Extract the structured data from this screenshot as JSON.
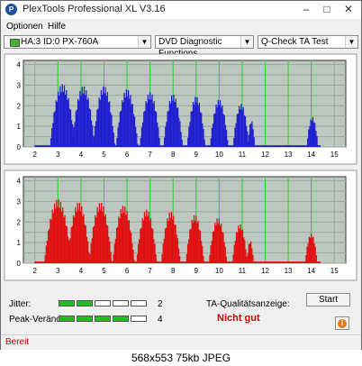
{
  "window": {
    "title": "PlexTools Professional XL V3.16",
    "app_icon_letter": "P"
  },
  "menu": [
    "Optionen",
    "Hilfe"
  ],
  "toolbar": {
    "drive": "HA:3 ID:0  PX-760A",
    "function": "DVD Diagnostic Functions",
    "test": "Q-Check TA Test"
  },
  "chart_data": [
    {
      "type": "bar",
      "name": "top-blue",
      "color": "#1f1fd0",
      "y_ticks": [
        "4",
        "3.5",
        "3",
        "2.5",
        "2",
        "1.5",
        "1",
        "0.5",
        "0"
      ],
      "x_ticks": [
        "2",
        "3",
        "4",
        "5",
        "6",
        "7",
        "8",
        "9",
        "10",
        "11",
        "12",
        "13",
        "14",
        "15"
      ],
      "xlim": [
        1.5,
        15.5
      ],
      "ylim": [
        0,
        4.2
      ],
      "peaks": [
        {
          "center": 3.2,
          "height": 3.05,
          "width": 0.55
        },
        {
          "center": 4.1,
          "height": 2.95,
          "width": 0.5
        },
        {
          "center": 5.0,
          "height": 2.95,
          "width": 0.48
        },
        {
          "center": 6.0,
          "height": 2.8,
          "width": 0.48
        },
        {
          "center": 7.0,
          "height": 2.65,
          "width": 0.45
        },
        {
          "center": 8.0,
          "height": 2.55,
          "width": 0.42
        },
        {
          "center": 9.0,
          "height": 2.45,
          "width": 0.4
        },
        {
          "center": 10.0,
          "height": 2.3,
          "width": 0.4
        },
        {
          "center": 10.95,
          "height": 2.1,
          "width": 0.35
        },
        {
          "center": 11.4,
          "height": 1.3,
          "width": 0.15
        },
        {
          "center": 14.05,
          "height": 1.45,
          "width": 0.25
        }
      ]
    },
    {
      "type": "bar",
      "name": "bottom-red",
      "color": "#e01010",
      "y_ticks": [
        "4",
        "3.5",
        "3",
        "2.5",
        "2",
        "1.5",
        "1",
        "0.5",
        "0"
      ],
      "x_ticks": [
        "2",
        "3",
        "4",
        "5",
        "6",
        "7",
        "8",
        "9",
        "10",
        "11",
        "12",
        "13",
        "14",
        "15"
      ],
      "xlim": [
        1.5,
        15.5
      ],
      "ylim": [
        0,
        4.2
      ],
      "peaks": [
        {
          "center": 3.0,
          "height": 3.1,
          "width": 0.6
        },
        {
          "center": 3.9,
          "height": 2.95,
          "width": 0.5
        },
        {
          "center": 4.85,
          "height": 2.95,
          "width": 0.5
        },
        {
          "center": 5.85,
          "height": 2.8,
          "width": 0.48
        },
        {
          "center": 6.85,
          "height": 2.6,
          "width": 0.45
        },
        {
          "center": 7.9,
          "height": 2.5,
          "width": 0.42
        },
        {
          "center": 8.95,
          "height": 2.35,
          "width": 0.4
        },
        {
          "center": 9.95,
          "height": 2.2,
          "width": 0.4
        },
        {
          "center": 10.9,
          "height": 1.9,
          "width": 0.33
        },
        {
          "center": 11.35,
          "height": 1.1,
          "width": 0.15
        },
        {
          "center": 14.0,
          "height": 1.45,
          "width": 0.27
        }
      ]
    }
  ],
  "metrics": {
    "jitter_label": "Jitter:",
    "jitter_value": "2",
    "jitter_leds_on": 2,
    "peak_label": "Peak-Veränd:",
    "peak_value": "4",
    "peak_leds_on": 4,
    "leds_total": 5
  },
  "quality": {
    "label": "TA-Qualitätsanzeige:",
    "verdict": "Nicht gut",
    "verdict_color": "#cc0000"
  },
  "buttons": {
    "start": "Start",
    "info_icon": "info-icon"
  },
  "status": {
    "text": "Bereit",
    "color": "#cc0000"
  },
  "caption": "568x553  75kb  JPEG"
}
